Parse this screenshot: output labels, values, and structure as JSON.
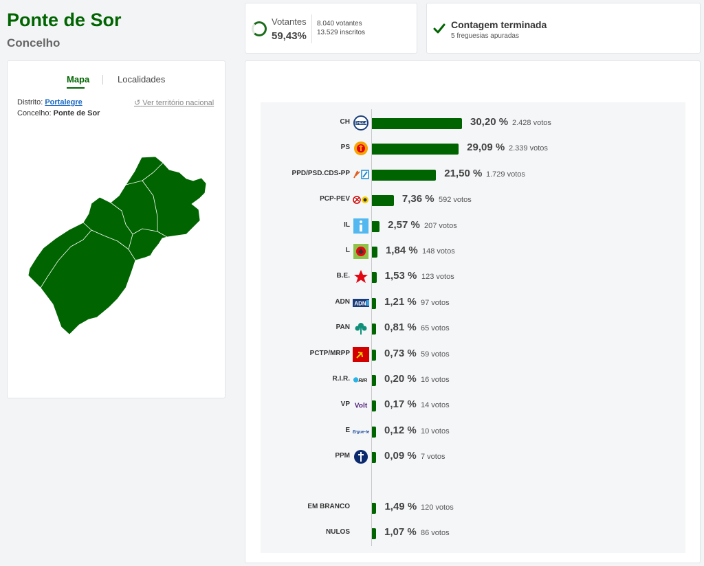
{
  "header": {
    "title": "Ponte de Sor",
    "subtitle": "Concelho"
  },
  "votantes": {
    "label": "Votantes",
    "pct": "59,43%",
    "votantes": "8.040 votantes",
    "inscritos": "13.529 inscritos",
    "progress": 0.5943
  },
  "contagem": {
    "title": "Contagem terminada",
    "sub": "5 freguesias apuradas"
  },
  "map": {
    "tabs": [
      "Mapa",
      "Localidades"
    ],
    "distrito_label": "Distrito:",
    "distrito_value": "Portalegre",
    "concelho_label": "Concelho:",
    "concelho_value": "Ponte de Sor",
    "link": "Ver território nacional"
  },
  "results": [
    {
      "party": "CH",
      "pct": "30,20 %",
      "votes": "2.428 votos",
      "value": 30.2,
      "logo": "chega-logo"
    },
    {
      "party": "PS",
      "pct": "29,09 %",
      "votes": "2.339 votos",
      "value": 29.09,
      "logo": "ps-logo"
    },
    {
      "party": "PPD/PSD.CDS-PP",
      "pct": "21,50 %",
      "votes": "1.729 votos",
      "value": 21.5,
      "logo": "psd-cds-logo"
    },
    {
      "party": "PCP-PEV",
      "pct": "7,36 %",
      "votes": "592 votos",
      "value": 7.36,
      "logo": "pcp-pev-logo"
    },
    {
      "party": "IL",
      "pct": "2,57 %",
      "votes": "207 votos",
      "value": 2.57,
      "logo": "il-logo"
    },
    {
      "party": "L",
      "pct": "1,84 %",
      "votes": "148 votos",
      "value": 1.84,
      "logo": "livre-logo"
    },
    {
      "party": "B.E.",
      "pct": "1,53 %",
      "votes": "123 votos",
      "value": 1.53,
      "logo": "be-logo"
    },
    {
      "party": "ADN",
      "pct": "1,21 %",
      "votes": "97 votos",
      "value": 1.21,
      "logo": "adn-logo"
    },
    {
      "party": "PAN",
      "pct": "0,81 %",
      "votes": "65 votos",
      "value": 0.81,
      "logo": "pan-logo"
    },
    {
      "party": "PCTP/MRPP",
      "pct": "0,73 %",
      "votes": "59 votos",
      "value": 0.73,
      "logo": "pctp-logo"
    },
    {
      "party": "R.I.R.",
      "pct": "0,20 %",
      "votes": "16 votos",
      "value": 0.2,
      "logo": "rir-logo"
    },
    {
      "party": "VP",
      "pct": "0,17 %",
      "votes": "14 votos",
      "value": 0.17,
      "logo": "volt-logo"
    },
    {
      "party": "E",
      "pct": "0,12 %",
      "votes": "10 votos",
      "value": 0.12,
      "logo": "ergue-te-logo"
    },
    {
      "party": "PPM",
      "pct": "0,09 %",
      "votes": "7 votos",
      "value": 0.09,
      "logo": "ppm-logo"
    }
  ],
  "extra": [
    {
      "party": "EM BRANCO",
      "pct": "1,49 %",
      "votes": "120 votos",
      "value": 1.49
    },
    {
      "party": "NULOS",
      "pct": "1,07 %",
      "votes": "86 votos",
      "value": 1.07
    }
  ],
  "colors": {
    "accent": "#006400",
    "link": "#1565c0"
  }
}
